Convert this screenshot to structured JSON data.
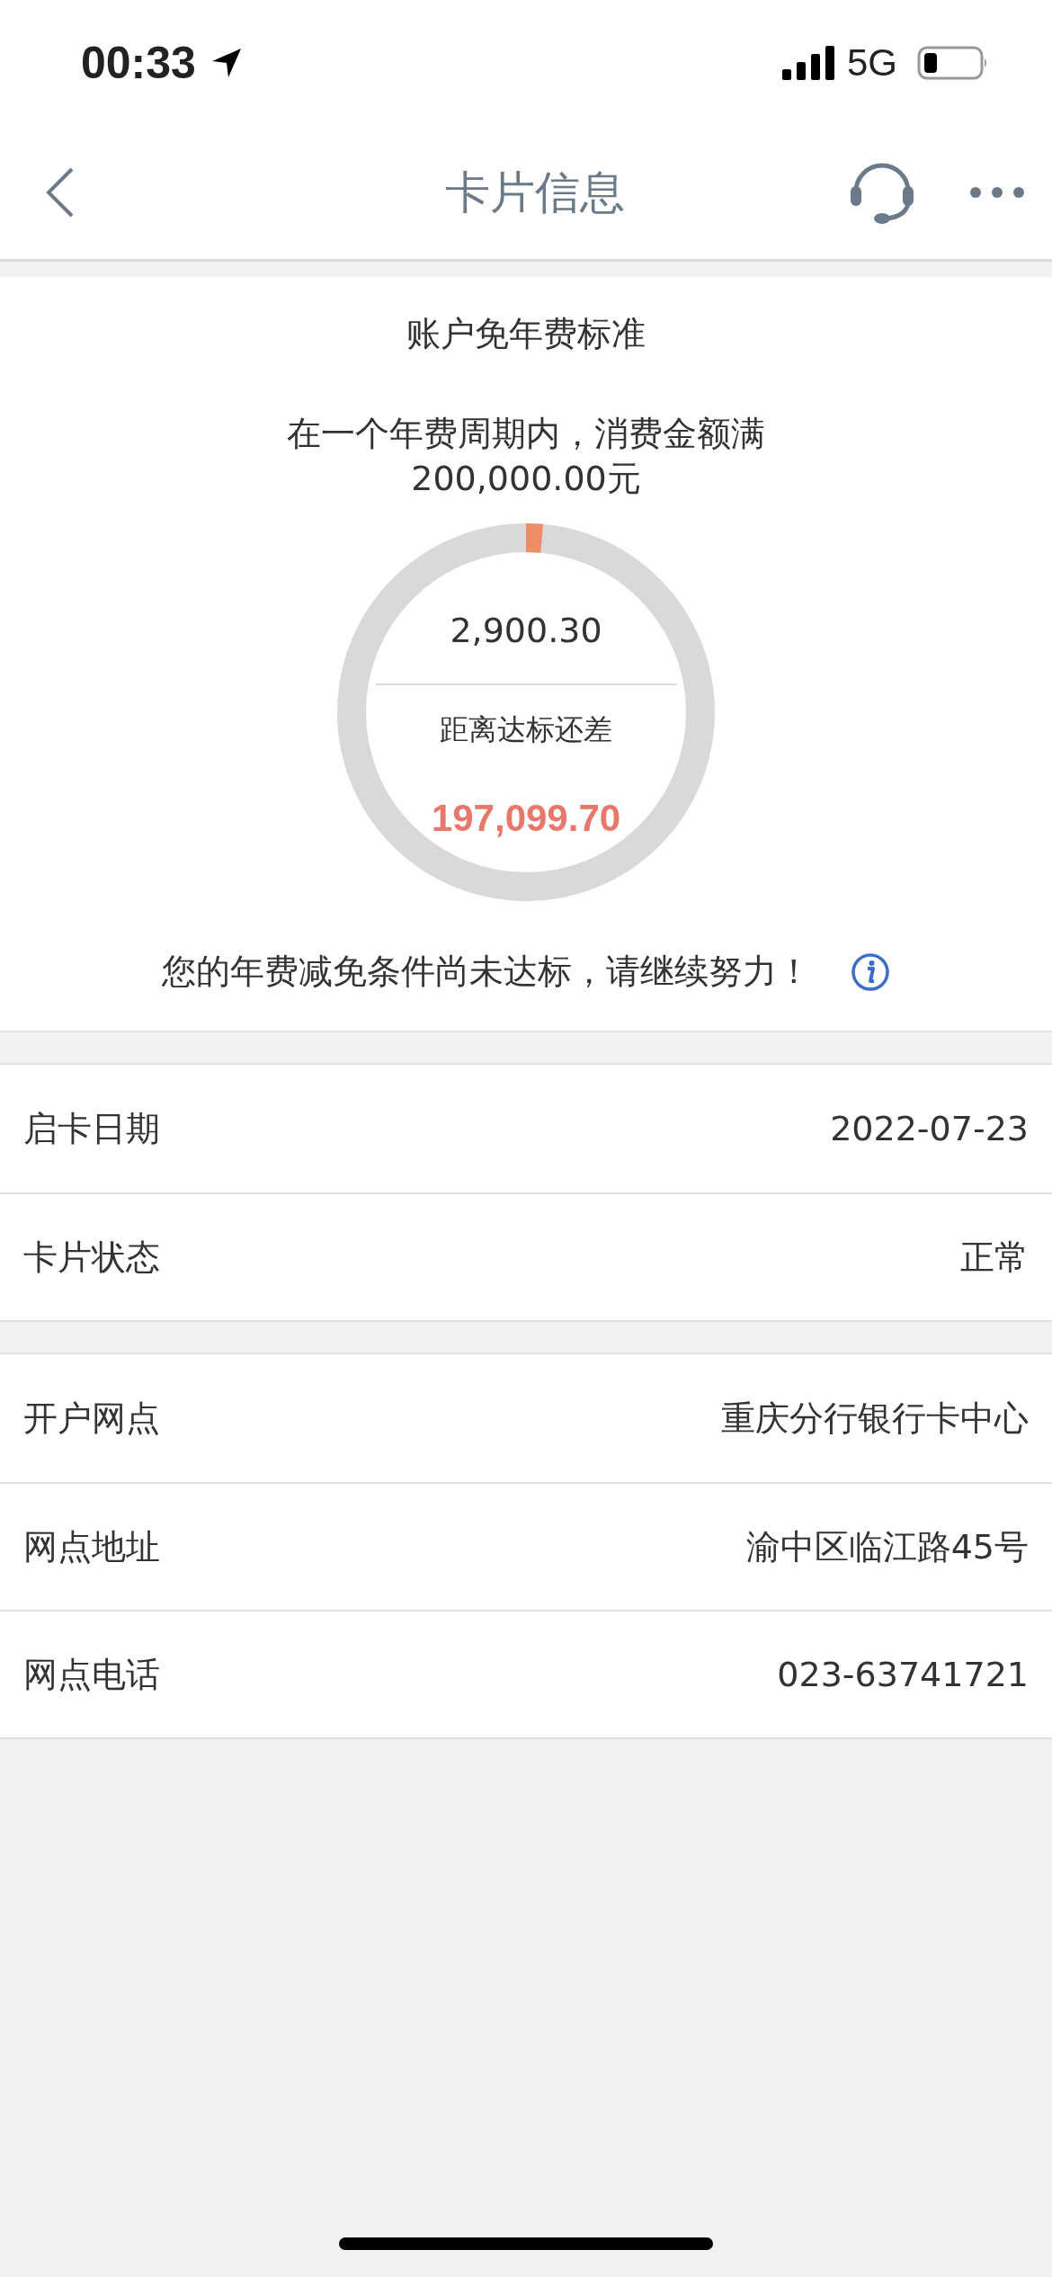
{
  "status_bar": {
    "time": "00:33",
    "network": "5G"
  },
  "nav": {
    "title": "卡片信息"
  },
  "fee_card": {
    "title": "账户免年费标准",
    "requirement": "在一个年费周期内，消费金额满200,000.00元",
    "progress": {
      "level": 0.0145,
      "spent": "2,900.30",
      "gap_label": "距离达标还差",
      "gap": "197,099.70"
    },
    "message": "您的年费减免条件尚未达标，请继续努力！"
  },
  "groups": [
    {
      "rows": [
        {
          "label": "启卡日期",
          "value": "2022-07-23"
        },
        {
          "label": "卡片状态",
          "value": "正常"
        }
      ]
    },
    {
      "rows": [
        {
          "label": "开户网点",
          "value": "重庆分行银行卡中心"
        },
        {
          "label": "网点地址",
          "value": "渝中区临江路45号"
        },
        {
          "label": "网点电话",
          "value": "023-63741721"
        }
      ]
    }
  ]
}
